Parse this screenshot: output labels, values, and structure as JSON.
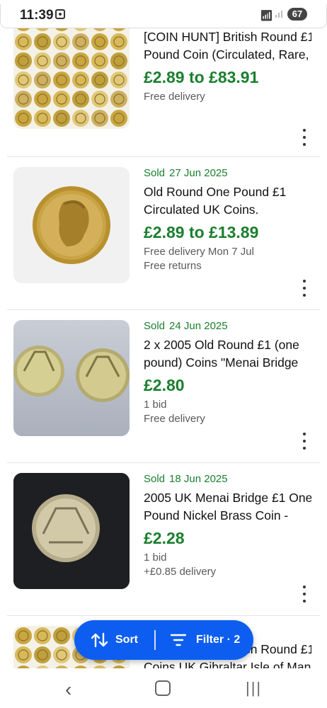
{
  "status_bar": {
    "time": "11:39",
    "battery": "67"
  },
  "listings": [
    {
      "sold": "",
      "title_lines": [
        "[COIN HUNT] British Round £1",
        "Pound Coin (Circulated, Rare,"
      ],
      "price": "£2.89 to £83.91",
      "meta": [
        "Free delivery"
      ]
    },
    {
      "sold": "Sold",
      "sold_date": "27 Jun 2025",
      "title_lines": [
        "Old Round One Pound £1",
        "Circulated UK Coins."
      ],
      "price": "£2.89 to £13.89",
      "meta": [
        "Free delivery Mon 7 Jul",
        "Free returns"
      ]
    },
    {
      "sold": "Sold",
      "sold_date": "24 Jun 2025",
      "title_lines": [
        "2 x 2005 Old Round £1 (one",
        "pound) Coins \"Menai Bridge"
      ],
      "price": "£2.80",
      "meta": [
        "1 bid",
        "Free delivery"
      ]
    },
    {
      "sold": "Sold",
      "sold_date": "18 Jun 2025",
      "title_lines": [
        "2005 UK Menai Bridge £1 One",
        "Pound Nickel Brass Coin -"
      ],
      "price": "£2.28",
      "meta": [
        "1 bid",
        "+£0.85 delivery"
      ]
    },
    {
      "sold": "",
      "title_lines": [
        "[COIN HUNT] British Round £1",
        "Coins UK Gibraltar Isle of Man"
      ]
    }
  ],
  "fab": {
    "sort_label": "Sort",
    "filter_label": "Filter · 2"
  },
  "colors": {
    "price_green": "#1a7f2e",
    "fab_blue": "#0d5ef0"
  },
  "icons": {
    "sort": "sort-arrows-icon",
    "filter": "filter-lines-icon",
    "more": "more-vertical-icon"
  }
}
